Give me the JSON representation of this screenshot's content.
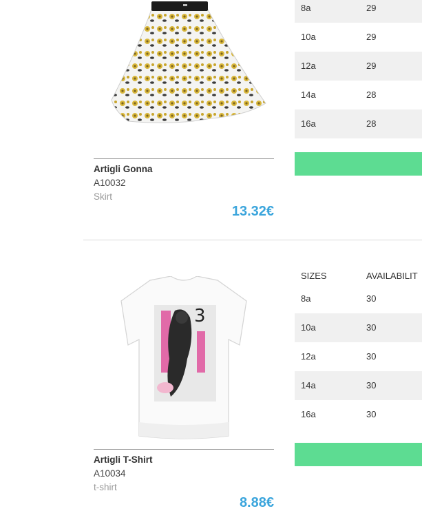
{
  "products": [
    {
      "name": "Artigli Gonna",
      "code": "A10032",
      "category": "Skirt",
      "price": "13.32€",
      "sizes_header": {
        "size": "",
        "availability": ""
      },
      "sizes": [
        {
          "size": "8a",
          "qty": "29"
        },
        {
          "size": "10a",
          "qty": "29"
        },
        {
          "size": "12a",
          "qty": "29"
        },
        {
          "size": "14a",
          "qty": "28"
        },
        {
          "size": "16a",
          "qty": "28"
        }
      ]
    },
    {
      "name": "Artigli T-Shirt",
      "code": "A10034",
      "category": "t-shirt",
      "price": "8.88€",
      "sizes_header": {
        "size": "SIZES",
        "availability": "AVAILABILIT"
      },
      "sizes": [
        {
          "size": "8a",
          "qty": "30"
        },
        {
          "size": "10a",
          "qty": "30"
        },
        {
          "size": "12a",
          "qty": "30"
        },
        {
          "size": "14a",
          "qty": "30"
        },
        {
          "size": "16a",
          "qty": "30"
        }
      ]
    }
  ],
  "colors": {
    "price": "#3ba5dc",
    "add_button": "#5ddc92",
    "row_alt": "#f0f0f0"
  }
}
